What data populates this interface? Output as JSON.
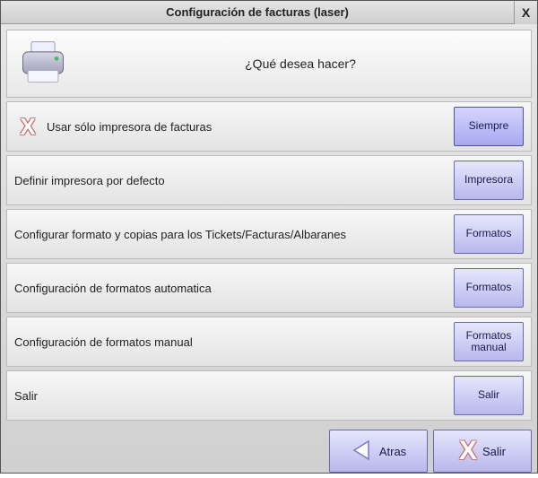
{
  "window": {
    "title": "Configuración de facturas (laser)",
    "close_label": "X"
  },
  "prompt": "¿Qué desea hacer?",
  "options": [
    {
      "label": "Usar sólo impresora de facturas",
      "button": "Siempre",
      "marked": true
    },
    {
      "label": "Definir impresora por defecto",
      "button": "Impresora",
      "marked": false
    },
    {
      "label": "Configurar formato y copias para los Tickets/Facturas/Albaranes",
      "button": "Formatos",
      "marked": false
    },
    {
      "label": "Configuración de formatos automatica",
      "button": "Formatos",
      "marked": false
    },
    {
      "label": "Configuración de formatos manual",
      "button": "Formatos manual",
      "marked": false
    },
    {
      "label": "Salir",
      "button": "Salir",
      "marked": false
    }
  ],
  "footer": {
    "back": "Atras",
    "exit": "Salir"
  }
}
